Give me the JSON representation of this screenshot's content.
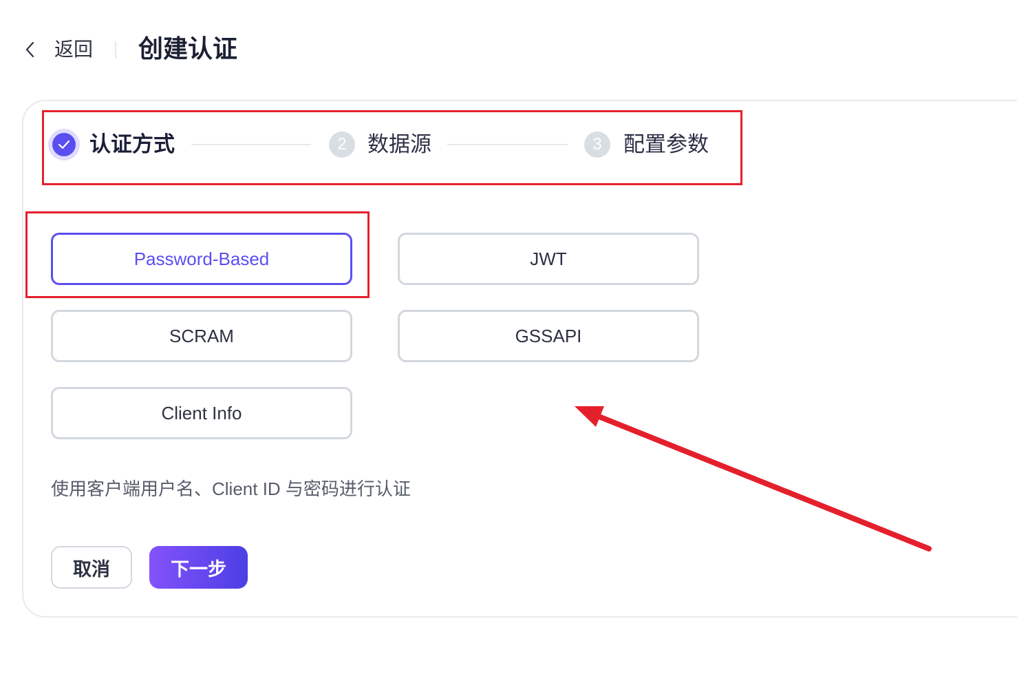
{
  "header": {
    "back_icon": "chevron-left-icon",
    "back_label": "返回",
    "title": "创建认证"
  },
  "steps": [
    {
      "label": "认证方式",
      "completed": true,
      "icon": "check-icon"
    },
    {
      "label": "数据源",
      "completed": false,
      "number": 2
    },
    {
      "label": "配置参数",
      "completed": false,
      "number": 3
    }
  ],
  "auth_methods": [
    {
      "label": "Password-Based",
      "selected": true
    },
    {
      "label": "JWT",
      "selected": false
    },
    {
      "label": "SCRAM",
      "selected": false
    },
    {
      "label": "GSSAPI",
      "selected": false
    },
    {
      "label": "Client Info",
      "selected": false
    }
  ],
  "description": "使用客户端用户名、Client ID 与密码进行认证",
  "actions": {
    "cancel_label": "取消",
    "next_label": "下一步"
  },
  "colors": {
    "accent": "#5b4ef0",
    "accent-halo": "#e0dcfd",
    "grad-start": "#8452fb",
    "grad-end": "#4c3fe4",
    "pending": "#d9dde4",
    "border": "#d3d7de",
    "annotation": "#e5202d"
  }
}
